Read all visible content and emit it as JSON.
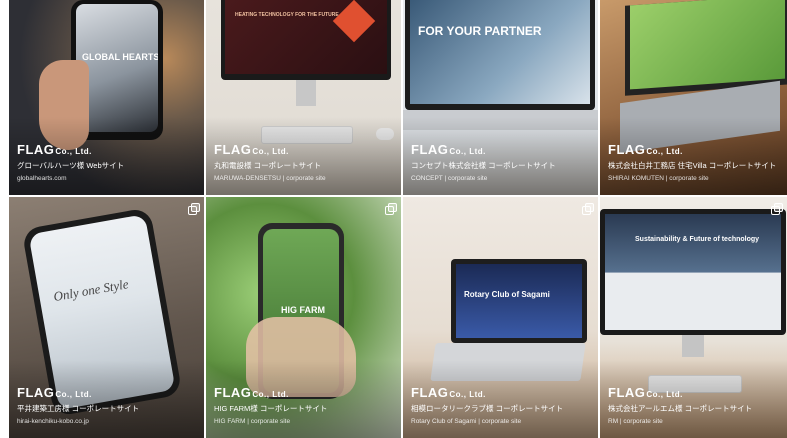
{
  "brand": {
    "name": "FLAG",
    "suffix": "Co., Ltd."
  },
  "posts": [
    {
      "title": "グローバルハーツ様 Webサイト",
      "url": "globalhearts.com",
      "screen_text": "GLOBAL HEARTS"
    },
    {
      "title": "丸和電設様 コーポレートサイト",
      "url": "MARUWA-DENSETSU | corporate site",
      "screen_text": "HEATING TECHNOLOGY FOR THE FUTURE"
    },
    {
      "title": "コンセプト株式会社様 コーポレートサイト",
      "url": "CONCEPT | corporate site",
      "screen_text": "FOR YOUR PARTNER"
    },
    {
      "title": "株式会社白井工務店 住宅Villa コーポレートサイト",
      "url": "SHIRAI KOMUTEN | corporate site",
      "screen_text": ""
    },
    {
      "title": "平井建築工房様 コーポレートサイト",
      "url": "hirai-kenchiku-kobo.co.jp",
      "screen_text": "Only one Style"
    },
    {
      "title": "HIG FARM様 コーポレートサイト",
      "url": "HIG FARM | corporate site",
      "screen_text": "HIG FARM"
    },
    {
      "title": "相模ロータリークラブ様 コーポレートサイト",
      "url": "Rotary Club of Sagami | corporate site",
      "screen_text": "Rotary Club of Sagami"
    },
    {
      "title": "株式会社アールエム様 コーポレートサイト",
      "url": "RM | corporate site",
      "screen_text": "Sustainability & Future of technology"
    }
  ]
}
